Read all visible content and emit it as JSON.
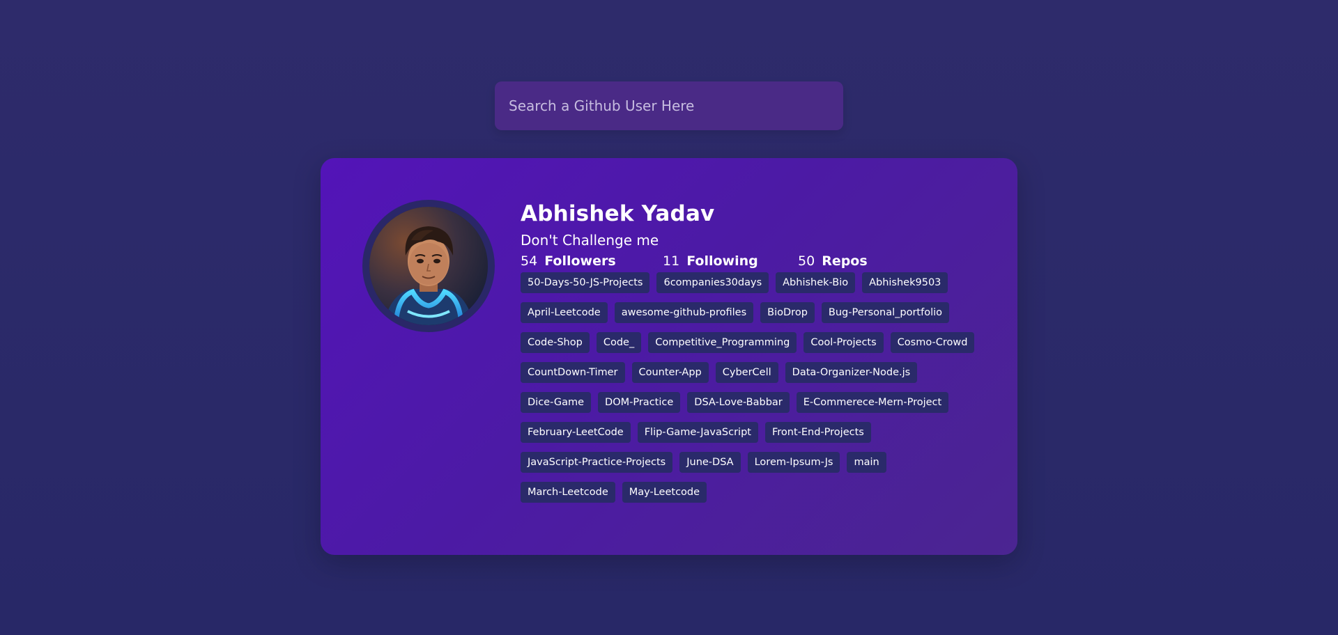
{
  "search": {
    "placeholder": "Search a Github User Here",
    "value": ""
  },
  "profile": {
    "name": "Abhishek Yadav",
    "bio": "Don't Challenge me",
    "avatar_icon": "user-avatar-icon",
    "followers": {
      "count": "54",
      "label": "Followers"
    },
    "following": {
      "count": "11",
      "label": "Following"
    },
    "repos": {
      "count": "50",
      "label": "Repos"
    }
  },
  "repos": [
    "50-Days-50-JS-Projects",
    "6companies30days",
    "Abhishek-Bio",
    "Abhishek9503",
    "April-Leetcode",
    "awesome-github-profiles",
    "BioDrop",
    "Bug-Personal_portfolio",
    "Code-Shop",
    "Code_",
    "Competitive_Programming",
    "Cool-Projects",
    "Cosmo-Crowd",
    "CountDown-Timer",
    "Counter-App",
    "CyberCell",
    "Data-Organizer-Node.js",
    "Dice-Game",
    "DOM-Practice",
    "DSA-Love-Babbar",
    "E-Commerece-Mern-Project",
    "February-LeetCode",
    "Flip-Game-JavaScript",
    "Front-End-Projects",
    "JavaScript-Practice-Projects",
    "June-DSA",
    "Lorem-Ipsum-Js",
    "main",
    "March-Leetcode",
    "May-Leetcode"
  ],
  "colors": {
    "background": "#2a2a6a",
    "card_start": "#5314b8",
    "card_end": "#4b2591",
    "search_bg": "#4a2a86",
    "repo_bg": "#2a2a6a"
  }
}
